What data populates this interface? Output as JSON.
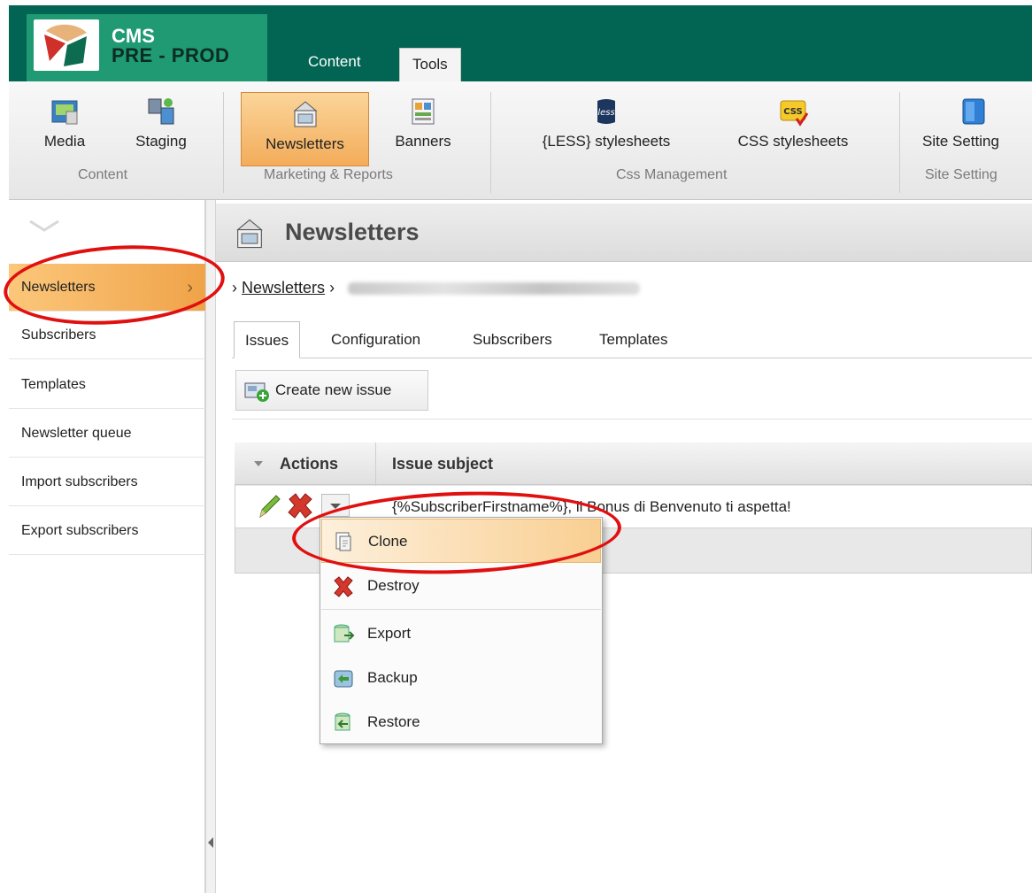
{
  "header": {
    "brand_line1": "CMS",
    "brand_line2": "PRE - PROD",
    "tabs": [
      {
        "label": "Content",
        "active": false
      },
      {
        "label": "Tools",
        "active": true
      }
    ],
    "colors": {
      "top_bar": "#026553",
      "brand_block": "#1f9a73",
      "accent": "#f0a349",
      "annotation": "#e01010"
    }
  },
  "ribbon": {
    "buttons": [
      {
        "label": "Media",
        "icon": "media-icon"
      },
      {
        "label": "Staging",
        "icon": "staging-icon"
      },
      {
        "label": "Newsletters",
        "icon": "newsletter-icon",
        "active": true
      },
      {
        "label": "Banners",
        "icon": "banners-icon"
      },
      {
        "label": "{LESS} stylesheets",
        "icon": "less-icon",
        "icon_text": "less"
      },
      {
        "label": "CSS stylesheets",
        "icon": "css-icon",
        "icon_text": "CSS"
      },
      {
        "label": "Site Setting",
        "icon": "site-settings-icon"
      }
    ],
    "groups": [
      "Content",
      "Marketing & Reports",
      "Css Management",
      "Site Setting"
    ]
  },
  "sidebar": {
    "items": [
      {
        "label": "Newsletters",
        "active": true
      },
      {
        "label": "Subscribers"
      },
      {
        "label": "Templates"
      },
      {
        "label": "Newsletter queue"
      },
      {
        "label": "Import subscribers"
      },
      {
        "label": "Export subscribers"
      }
    ]
  },
  "main": {
    "title": "Newsletters",
    "breadcrumb": {
      "root": "Newsletters"
    },
    "tabs": [
      {
        "label": "Issues",
        "active": true
      },
      {
        "label": "Configuration"
      },
      {
        "label": "Subscribers"
      },
      {
        "label": "Templates"
      }
    ],
    "create_button": "Create new issue",
    "grid": {
      "columns": [
        "Actions",
        "Issue subject"
      ],
      "rows": [
        {
          "subject": "{%SubscriberFirstname%}, il Bonus di Benvenuto ti aspetta!"
        }
      ]
    },
    "context_menu": {
      "items": [
        {
          "label": "Clone",
          "icon": "clone-icon",
          "highlighted": true
        },
        {
          "label": "Destroy",
          "icon": "destroy-icon"
        },
        {
          "label": "Export",
          "icon": "export-icon"
        },
        {
          "label": "Backup",
          "icon": "backup-icon"
        },
        {
          "label": "Restore",
          "icon": "restore-icon"
        }
      ]
    }
  }
}
